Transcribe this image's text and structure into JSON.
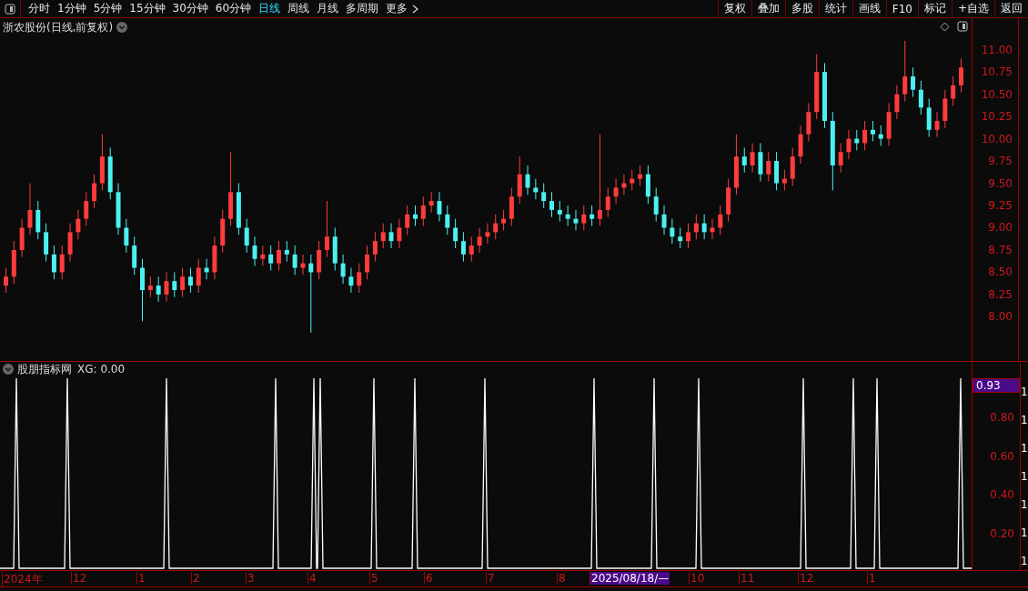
{
  "toolbar": {
    "tabs": [
      {
        "label": "分时",
        "selected": false
      },
      {
        "label": "1分钟",
        "selected": false
      },
      {
        "label": "5分钟",
        "selected": false
      },
      {
        "label": "15分钟",
        "selected": false
      },
      {
        "label": "30分钟",
        "selected": false
      },
      {
        "label": "60分钟",
        "selected": false
      },
      {
        "label": "日线",
        "selected": true
      },
      {
        "label": "周线",
        "selected": false
      },
      {
        "label": "月线",
        "selected": false
      },
      {
        "label": "多周期",
        "selected": false
      },
      {
        "label": "更多",
        "selected": false
      }
    ],
    "buttons": [
      "复权",
      "叠加",
      "多股",
      "统计",
      "画线",
      "F10",
      "标记",
      "+自选",
      "返回"
    ]
  },
  "main_chart": {
    "title": "浙农股份(日线,前复权)",
    "chart_data": {
      "type": "candlestick",
      "ylim": [
        5.15,
        11.35
      ],
      "yticks": [
        {
          "value": 11,
          "label": "11.00"
        },
        {
          "value": 10.75,
          "label": "10.75"
        },
        {
          "value": 10.5,
          "label": "10.50"
        },
        {
          "value": 10.25,
          "label": "10.25"
        },
        {
          "value": 10,
          "label": "10.00"
        },
        {
          "value": 9.75,
          "label": "9.75"
        },
        {
          "value": 9.5,
          "label": "9.50"
        },
        {
          "value": 9.25,
          "label": "9.25"
        },
        {
          "value": 9,
          "label": "9.00"
        },
        {
          "value": 8.75,
          "label": "8.75"
        },
        {
          "value": 8.5,
          "label": "8.50"
        },
        {
          "value": 8.25,
          "label": "8.25"
        },
        {
          "value": 8,
          "label": "8.00"
        }
      ],
      "ohlc": [
        [
          8.35,
          8.55,
          8.27,
          8.45
        ],
        [
          8.45,
          8.85,
          8.37,
          8.75
        ],
        [
          8.75,
          9.1,
          8.67,
          9.0
        ],
        [
          9.0,
          9.5,
          8.92,
          9.2
        ],
        [
          9.2,
          9.3,
          8.87,
          8.95
        ],
        [
          8.95,
          9.05,
          8.62,
          8.7
        ],
        [
          8.7,
          8.8,
          8.42,
          8.5
        ],
        [
          8.5,
          8.8,
          8.42,
          8.7
        ],
        [
          8.7,
          9.05,
          8.62,
          8.95
        ],
        [
          8.95,
          9.2,
          8.87,
          9.1
        ],
        [
          9.1,
          9.4,
          9.02,
          9.3
        ],
        [
          9.3,
          9.6,
          9.22,
          9.5
        ],
        [
          9.5,
          10.05,
          9.42,
          9.8
        ],
        [
          9.8,
          9.9,
          9.32,
          9.4
        ],
        [
          9.4,
          9.5,
          8.92,
          9.0
        ],
        [
          9.0,
          9.1,
          8.72,
          8.8
        ],
        [
          8.8,
          8.9,
          8.47,
          8.55
        ],
        [
          8.55,
          8.65,
          7.95,
          8.3
        ],
        [
          8.3,
          8.45,
          8.22,
          8.35
        ],
        [
          8.35,
          8.45,
          8.17,
          8.25
        ],
        [
          8.25,
          8.5,
          8.17,
          8.4
        ],
        [
          8.4,
          8.5,
          8.22,
          8.3
        ],
        [
          8.3,
          8.55,
          8.22,
          8.45
        ],
        [
          8.45,
          8.55,
          8.27,
          8.35
        ],
        [
          8.35,
          8.65,
          8.27,
          8.55
        ],
        [
          8.55,
          8.65,
          8.42,
          8.5
        ],
        [
          8.5,
          8.9,
          8.42,
          8.8
        ],
        [
          8.8,
          9.2,
          8.72,
          9.1
        ],
        [
          9.1,
          9.85,
          9.02,
          9.4
        ],
        [
          9.4,
          9.5,
          8.92,
          9.0
        ],
        [
          9.0,
          9.1,
          8.72,
          8.8
        ],
        [
          8.8,
          8.9,
          8.57,
          8.65
        ],
        [
          8.65,
          8.8,
          8.57,
          8.7
        ],
        [
          8.7,
          8.8,
          8.52,
          8.6
        ],
        [
          8.6,
          8.85,
          8.52,
          8.75
        ],
        [
          8.75,
          8.85,
          8.62,
          8.7
        ],
        [
          8.7,
          8.8,
          8.47,
          8.55
        ],
        [
          8.55,
          8.7,
          8.47,
          8.6
        ],
        [
          8.6,
          8.7,
          7.82,
          8.5
        ],
        [
          8.5,
          8.85,
          8.42,
          8.75
        ],
        [
          8.75,
          9.3,
          8.67,
          8.9
        ],
        [
          8.9,
          9.0,
          8.52,
          8.6
        ],
        [
          8.6,
          8.7,
          8.37,
          8.45
        ],
        [
          8.45,
          8.55,
          8.27,
          8.35
        ],
        [
          8.35,
          8.6,
          8.27,
          8.5
        ],
        [
          8.5,
          8.8,
          8.42,
          8.7
        ],
        [
          8.7,
          8.95,
          8.62,
          8.85
        ],
        [
          8.85,
          9.05,
          8.77,
          8.95
        ],
        [
          8.95,
          9.05,
          8.77,
          8.85
        ],
        [
          8.85,
          9.1,
          8.77,
          9.0
        ],
        [
          9.0,
          9.25,
          8.92,
          9.15
        ],
        [
          9.15,
          9.25,
          9.02,
          9.1
        ],
        [
          9.1,
          9.35,
          9.02,
          9.25
        ],
        [
          9.25,
          9.4,
          9.17,
          9.3
        ],
        [
          9.3,
          9.4,
          9.07,
          9.15
        ],
        [
          9.15,
          9.25,
          8.92,
          9.0
        ],
        [
          9.0,
          9.1,
          8.77,
          8.85
        ],
        [
          8.85,
          8.95,
          8.62,
          8.7
        ],
        [
          8.7,
          8.9,
          8.62,
          8.8
        ],
        [
          8.8,
          9.0,
          8.72,
          8.9
        ],
        [
          8.9,
          9.05,
          8.82,
          8.95
        ],
        [
          8.95,
          9.15,
          8.87,
          9.05
        ],
        [
          9.05,
          9.2,
          8.97,
          9.1
        ],
        [
          9.1,
          9.45,
          9.02,
          9.35
        ],
        [
          9.35,
          9.8,
          9.27,
          9.6
        ],
        [
          9.6,
          9.7,
          9.37,
          9.45
        ],
        [
          9.45,
          9.55,
          9.32,
          9.4
        ],
        [
          9.4,
          9.5,
          9.22,
          9.3
        ],
        [
          9.3,
          9.4,
          9.12,
          9.2
        ],
        [
          9.2,
          9.3,
          9.07,
          9.15
        ],
        [
          9.15,
          9.25,
          9.02,
          9.1
        ],
        [
          9.1,
          9.2,
          8.97,
          9.05
        ],
        [
          9.05,
          9.25,
          8.97,
          9.15
        ],
        [
          9.15,
          9.25,
          9.02,
          9.1
        ],
        [
          9.1,
          10.05,
          9.02,
          9.2
        ],
        [
          9.2,
          9.45,
          9.12,
          9.35
        ],
        [
          9.35,
          9.55,
          9.27,
          9.45
        ],
        [
          9.45,
          9.6,
          9.37,
          9.5
        ],
        [
          9.5,
          9.65,
          9.42,
          9.55
        ],
        [
          9.55,
          9.7,
          9.47,
          9.6
        ],
        [
          9.6,
          9.7,
          9.27,
          9.35
        ],
        [
          9.35,
          9.45,
          9.07,
          9.15
        ],
        [
          9.15,
          9.25,
          8.92,
          9.0
        ],
        [
          9.0,
          9.1,
          8.82,
          8.9
        ],
        [
          8.9,
          9.0,
          8.77,
          8.85
        ],
        [
          8.85,
          9.05,
          8.77,
          8.95
        ],
        [
          8.95,
          9.15,
          8.87,
          9.05
        ],
        [
          9.05,
          9.15,
          8.87,
          8.95
        ],
        [
          8.95,
          9.1,
          8.87,
          9.0
        ],
        [
          9.0,
          9.25,
          8.92,
          9.15
        ],
        [
          9.15,
          9.55,
          9.07,
          9.45
        ],
        [
          9.45,
          10.05,
          9.37,
          9.8
        ],
        [
          9.8,
          9.9,
          9.62,
          9.7
        ],
        [
          9.7,
          9.95,
          9.62,
          9.85
        ],
        [
          9.85,
          9.95,
          9.52,
          9.6
        ],
        [
          9.6,
          9.85,
          9.52,
          9.75
        ],
        [
          9.75,
          9.85,
          9.42,
          9.5
        ],
        [
          9.5,
          9.65,
          9.42,
          9.55
        ],
        [
          9.55,
          9.9,
          9.47,
          9.8
        ],
        [
          9.8,
          10.15,
          9.72,
          10.05
        ],
        [
          10.05,
          10.4,
          9.97,
          10.3
        ],
        [
          10.3,
          10.95,
          10.22,
          10.75
        ],
        [
          10.75,
          10.85,
          10.12,
          10.2
        ],
        [
          10.2,
          10.3,
          9.42,
          9.7
        ],
        [
          9.7,
          9.95,
          9.62,
          9.85
        ],
        [
          9.85,
          10.1,
          9.77,
          10.0
        ],
        [
          10.0,
          10.1,
          9.87,
          9.95
        ],
        [
          9.95,
          10.2,
          9.87,
          10.1
        ],
        [
          10.1,
          10.2,
          9.97,
          10.05
        ],
        [
          10.05,
          10.15,
          9.92,
          10.0
        ],
        [
          10.0,
          10.4,
          9.92,
          10.3
        ],
        [
          10.3,
          10.6,
          10.22,
          10.5
        ],
        [
          10.5,
          11.1,
          10.42,
          10.7
        ],
        [
          10.7,
          10.8,
          10.47,
          10.55
        ],
        [
          10.55,
          10.65,
          10.27,
          10.35
        ],
        [
          10.35,
          10.45,
          10.02,
          10.1
        ],
        [
          10.1,
          10.3,
          10.02,
          10.2
        ],
        [
          10.2,
          10.55,
          10.12,
          10.45
        ],
        [
          10.45,
          10.7,
          10.37,
          10.6
        ],
        [
          10.6,
          10.9,
          10.52,
          10.8
        ]
      ]
    }
  },
  "indicator": {
    "title": "股朋指标网",
    "reading": "XG: 0.00",
    "current_value": "0.93",
    "y_ticks": [
      "0.80",
      "0.60",
      "0.40",
      "0.20"
    ]
  },
  "date_axis": {
    "labels": [
      {
        "label": "2024年",
        "selected": false
      },
      {
        "label": "12",
        "selected": false
      },
      {
        "label": "1",
        "selected": false
      },
      {
        "label": "2",
        "selected": false
      },
      {
        "label": "3",
        "selected": false
      },
      {
        "label": "4",
        "selected": false
      },
      {
        "label": "5",
        "selected": false
      },
      {
        "label": "6",
        "selected": false
      },
      {
        "label": "7",
        "selected": false
      },
      {
        "label": "8",
        "selected": false
      },
      {
        "label": "2025/08/18/—",
        "selected": true
      },
      {
        "label": "10",
        "selected": false
      },
      {
        "label": "11",
        "selected": false
      },
      {
        "label": "12",
        "selected": false
      },
      {
        "label": "1",
        "selected": false
      }
    ]
  },
  "side_strip": {
    "items": [
      "1",
      "1",
      "1",
      "1",
      "1",
      "1",
      "1"
    ]
  }
}
